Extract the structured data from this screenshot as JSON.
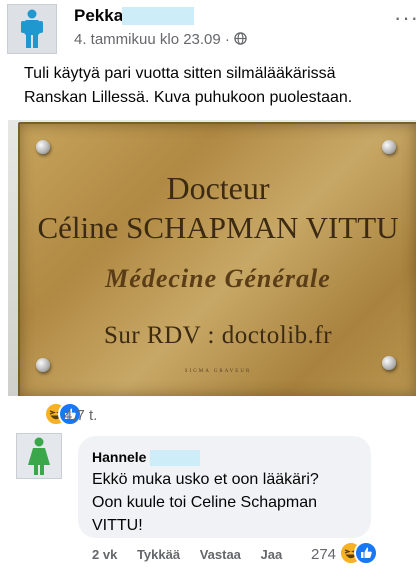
{
  "post": {
    "author": "Pekka",
    "timestamp": "4. tammikuu klo 23.09",
    "separator": "·",
    "privacy_icon": "globe-icon",
    "more_label": "···",
    "text_lines": [
      "Tuli käytyä pari vuotta sitten silmälääkärissä",
      "Ranskan Lillessä. Kuva puhukoon puolestaan."
    ],
    "image": {
      "title": "Docteur",
      "name": "Céline SCHAPMAN VITTU",
      "specialty": "Médecine Générale",
      "appointment": "Sur RDV : doctolib.fr",
      "maker": "SIGMA GRAVEUR"
    },
    "reaction_icons": [
      "haha-icon",
      "like-icon"
    ],
    "reaction_count": "4,7 t."
  },
  "comment": {
    "author": "Hannele",
    "text_lines": [
      "Ekkö muka usko et oon lääkäri?",
      "Oon kuule toi Celine Schapman",
      "VITTU!"
    ],
    "age": "2 vk",
    "like_label": "Tykkää",
    "reply_label": "Vastaa",
    "share_label": "Jaa",
    "reaction_count": "274",
    "reaction_icons": [
      "haha-icon",
      "like-icon"
    ]
  },
  "colors": {
    "redaction": "#cdeef9",
    "secondary_text": "#65676b",
    "like_blue": "#1877f2",
    "haha_yellow": "#f7b125",
    "bubble_bg": "#f0f2f5",
    "post_avatar_figure": "#1f97cf",
    "comment_avatar_figure": "#3aa84a"
  }
}
